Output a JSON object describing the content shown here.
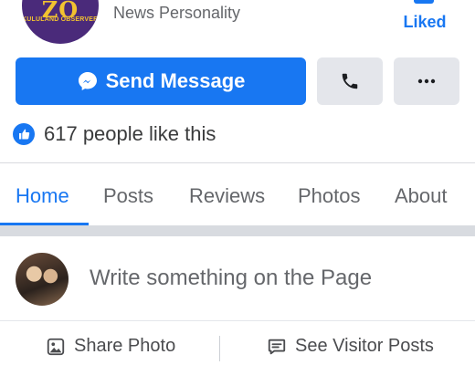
{
  "header": {
    "logo_text": "ZO",
    "logo_caption": "KULULAND OBSERVERS",
    "subtitle": "News Personality",
    "liked_label": "Liked"
  },
  "actions_row": {
    "send_message_label": "Send Message",
    "icons": {
      "send": "messenger-icon",
      "call": "phone-icon",
      "more": "more-icon"
    }
  },
  "likes": {
    "text": "617 people like this",
    "icon": "thumbs-up-icon"
  },
  "tabs": [
    {
      "label": "Home",
      "active": true
    },
    {
      "label": "Posts",
      "active": false
    },
    {
      "label": "Reviews",
      "active": false
    },
    {
      "label": "Photos",
      "active": false
    },
    {
      "label": "About",
      "active": false
    }
  ],
  "composer": {
    "placeholder": "Write something on the Page"
  },
  "bottom_actions": [
    {
      "label": "Share Photo",
      "icon": "photo-icon"
    },
    {
      "label": "See Visitor Posts",
      "icon": "chat-icon"
    }
  ],
  "colors": {
    "accent": "#1877f2",
    "button_bg": "#e4e6eb",
    "secondary_text": "#65676b",
    "logo_bg": "#4a2a7a",
    "logo_text": "#f2c230"
  }
}
